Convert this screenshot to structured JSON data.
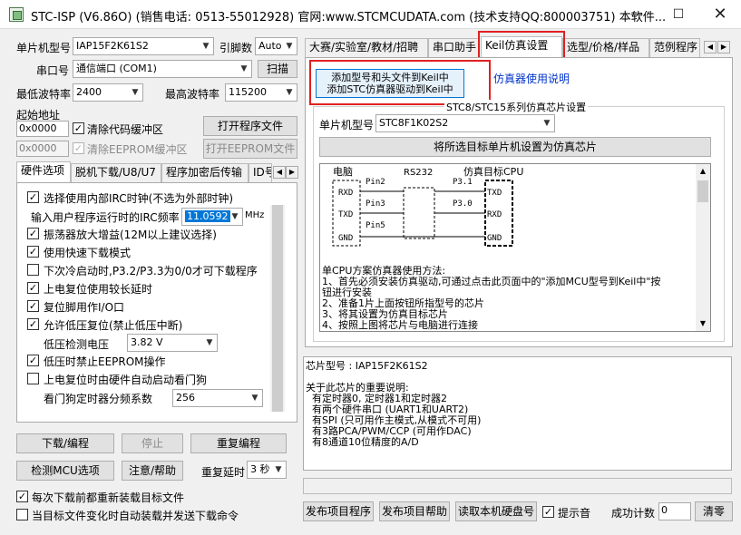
{
  "title": "STC-ISP (V6.86O) (销售电话: 0513-55012928) 官网:www.STCMCUDATA.com (技术支持QQ:800003751) 本软件...",
  "left": {
    "mcu_type_label": "单片机型号",
    "mcu_type_value": "IAP15F2K61S2",
    "pin_label": "引脚数",
    "pin_value": "Auto",
    "port_label": "串口号",
    "port_value": "通信端口 (COM1)",
    "scan_label": "扫描",
    "min_baud_label": "最低波特率",
    "min_baud_value": "2400",
    "max_baud_label": "最高波特率",
    "max_baud_value": "115200",
    "start_addr_label": "起始地址",
    "addr1_value": "0x0000",
    "clear_code_label": "清除代码缓冲区",
    "open_prog_label": "打开程序文件",
    "addr2_value": "0x0000",
    "clear_eeprom_label": "清除EEPROM缓冲区",
    "open_eeprom_label": "打开EEPROM文件",
    "tabs": [
      "硬件选项",
      "脱机下载/U8/U7",
      "程序加密后传输",
      "ID号"
    ],
    "options": [
      {
        "checked": true,
        "text": "选择使用内部IRC时钟(不选为外部时钟)"
      },
      {
        "checked": true,
        "text": "振荡器放大增益(12M以上建议选择)"
      },
      {
        "checked": true,
        "text": "使用快速下载模式"
      },
      {
        "checked": false,
        "text": "下次冷启动时,P3.2/P3.3为0/0才可下载程序"
      },
      {
        "checked": true,
        "text": "上电复位使用较长延时"
      },
      {
        "checked": true,
        "text": "复位脚用作I/O口"
      },
      {
        "checked": true,
        "text": "允许低压复位(禁止低压中断)"
      },
      {
        "checked": true,
        "text": "低压时禁止EEPROM操作"
      },
      {
        "checked": false,
        "text": "上电复位时由硬件自动启动看门狗"
      }
    ],
    "irc_label": "输入用户程序运行时的IRC频率",
    "irc_value": "11.0592",
    "irc_unit": "MHz",
    "lv_label": "低压检测电压",
    "lv_value": "3.82 V",
    "wdt_label": "看门狗定时器分频系数",
    "wdt_value": "256",
    "download_label": "下载/编程",
    "stop_label": "停止",
    "reprogram_label": "重复编程",
    "detect_label": "检测MCU选项",
    "help_label": "注意/帮助",
    "delay_label": "重复延时",
    "delay_value": "3 秒",
    "reload_label": "每次下载前都重新装载目标文件",
    "autoload_label": "当目标文件变化时自动装载并发送下载命令"
  },
  "right": {
    "tabs": [
      "大赛/实验室/教材/招聘",
      "串口助手",
      "Keil仿真设置",
      "选型/价格/样品",
      "范例程序"
    ],
    "add_btn_line1": "添加型号和头文件到Keil中",
    "add_btn_line2": "添加STC仿真器驱动到Keil中",
    "emu_help_link": "仿真器使用说明",
    "group_title": "STC8/STC15系列仿真芯片设置",
    "chip_label": "单片机型号",
    "chip_value": "STC8F1K02S2",
    "set_chip_btn": "将所选目标单片机设置为仿真芯片",
    "diagram": {
      "pc": "电脑",
      "rs232": "RS232",
      "target": "仿真目标CPU",
      "rxd": "RXD",
      "txd": "TXD",
      "gnd": "GND",
      "pin2": "Pin2",
      "pin3": "Pin3",
      "pin5": "Pin5",
      "p31": "P3.1",
      "p30": "P3.0"
    },
    "method_lines": [
      "单CPU方案仿真器使用方法:",
      "1、首先必须安装仿真驱动,可通过点击此页面中的\"添加MCU型号到Keil中\"按",
      "钮进行安装",
      "2、准备1片上面按钮所指型号的芯片",
      "3、将其设置为仿真目标芯片",
      "4、按照上图将芯片与电脑进行连接"
    ],
    "info_lines": [
      "芯片型号 : IAP15F2K61S2",
      "",
      "关于此芯片的重要说明:",
      "  有定时器0, 定时器1和定时器2",
      "  有两个硬件串口 (UART1和UART2)",
      "  有SPI (只可用作主模式,从模式不可用)",
      "  有3路PCA/PWM/CCP (可用作DAC)",
      "  有8通道10位精度的A/D"
    ],
    "pub_prog_label": "发布项目程序",
    "pub_help_label": "发布项目帮助",
    "read_disk_label": "读取本机硬盘号",
    "beep_label": "提示音",
    "count_label": "成功计数",
    "count_value": "0",
    "clear_label": "清零"
  },
  "colors": {
    "highlight": "#e02020",
    "link": "#0033cc",
    "selected": "#0078d7"
  }
}
